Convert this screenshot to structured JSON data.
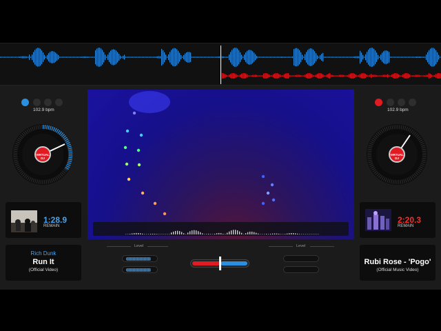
{
  "colors": {
    "deck_a": "#2b8fe0",
    "deck_b": "#e01b24",
    "background": "#1b1b1b"
  },
  "deck_a": {
    "bpm": "102.9 bpm",
    "platter_label": "VIRTUAL DJ",
    "time": "1:28.9",
    "remain_label": "REMAIN",
    "artist": "Rich Dunk",
    "title": "Run It",
    "subtitle": "(Official Video)",
    "level_label": "Level",
    "level_fraction": 0.85
  },
  "deck_b": {
    "bpm": "102.9 bpm",
    "platter_label": "VIRTUAL DJ",
    "time": "2:20.3",
    "remain_label": "REMAIN",
    "title": "Rubi Rose - 'Pogo'",
    "subtitle": "(Official Music Video)",
    "level_label": "Level",
    "level_fraction": 0.0
  },
  "crossfader": {
    "position": 0.5,
    "icon": "crossfader-handle"
  }
}
